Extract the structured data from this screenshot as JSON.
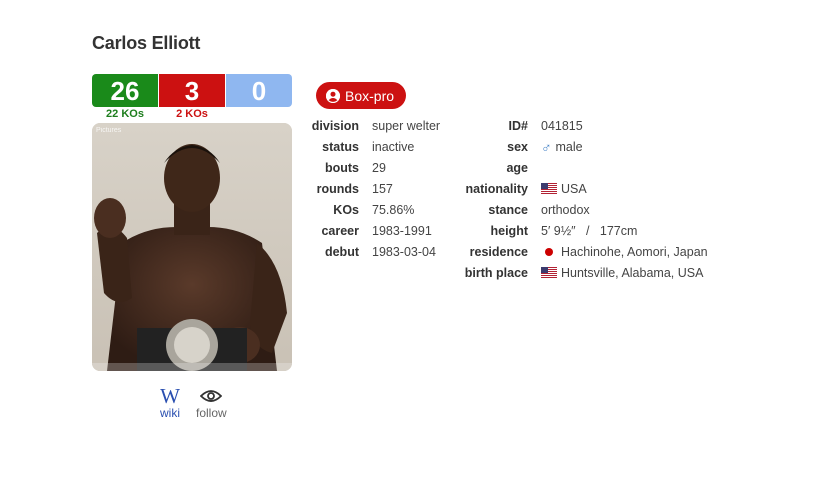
{
  "boxer": {
    "name": "Carlos Elliott"
  },
  "record": {
    "wins": "26",
    "losses": "3",
    "draws": "0",
    "win_kos": "22 KOs",
    "loss_kos": "2 KOs",
    "colors": {
      "win": "#1a8a1a",
      "loss": "#cc1111",
      "draw": "#8fb7f0",
      "win_text": "#1e7e1e",
      "loss_text": "#cc1111"
    }
  },
  "photo": {
    "caption": "Pictures"
  },
  "links": {
    "wiki_label": "wiki",
    "follow_label": "follow"
  },
  "badge": {
    "label": "Box-pro",
    "icon": "user-circle-icon"
  },
  "left_info": [
    {
      "label": "division",
      "value": "super welter"
    },
    {
      "label": "status",
      "value": "inactive"
    },
    {
      "label": "bouts",
      "value": "29"
    },
    {
      "label": "rounds",
      "value": "157"
    },
    {
      "label": "KOs",
      "value": "75.86%"
    },
    {
      "label": "career",
      "value": "1983-1991"
    },
    {
      "label": "debut",
      "value": "1983-03-04"
    }
  ],
  "right_info": {
    "id_label": "ID#",
    "id_value": "041815",
    "sex_label": "sex",
    "sex_value": "male",
    "sex_icon": "male-symbol-icon",
    "age_label": "age",
    "age_value": "",
    "nationality_label": "nationality",
    "nationality_value": "USA",
    "nationality_flag": "us-flag-icon",
    "stance_label": "stance",
    "stance_value": "orthodox",
    "height_label": "height",
    "height_value": "5′ 9½″   /   177cm",
    "residence_label": "residence",
    "residence_value": "Hachinohe, Aomori, Japan",
    "residence_flag": "japan-flag-icon",
    "birthplace_label": "birth place",
    "birthplace_value": "Huntsville, Alabama, USA",
    "birthplace_flag": "us-flag-icon"
  }
}
